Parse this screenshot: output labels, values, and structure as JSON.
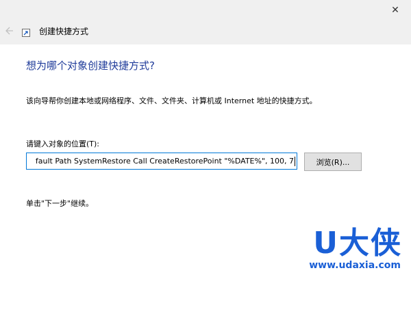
{
  "window": {
    "close_glyph": "✕",
    "title": "创建快捷方式"
  },
  "icons": {
    "close": "close-icon",
    "back": "back-arrow-icon",
    "shortcut": "shortcut-icon"
  },
  "main": {
    "heading": "想为哪个对象创建快捷方式?",
    "description": "该向导帮你创建本地或网络程序、文件、文件夹、计算机或 Internet 地址的快捷方式。",
    "field_label": "请键入对象的位置(T):",
    "field_value": "fault Path SystemRestore Call CreateRestorePoint \"%DATE%\", 100, 7",
    "browse_label": "浏览(R)...",
    "hint": "单击\"下一步\"继续。"
  },
  "watermark": {
    "brand": "U大侠",
    "url": "www.udaxia.com"
  },
  "colors": {
    "heading": "#1f3b9a",
    "focus_border": "#0078d7",
    "watermark": "#1a5fd6"
  }
}
